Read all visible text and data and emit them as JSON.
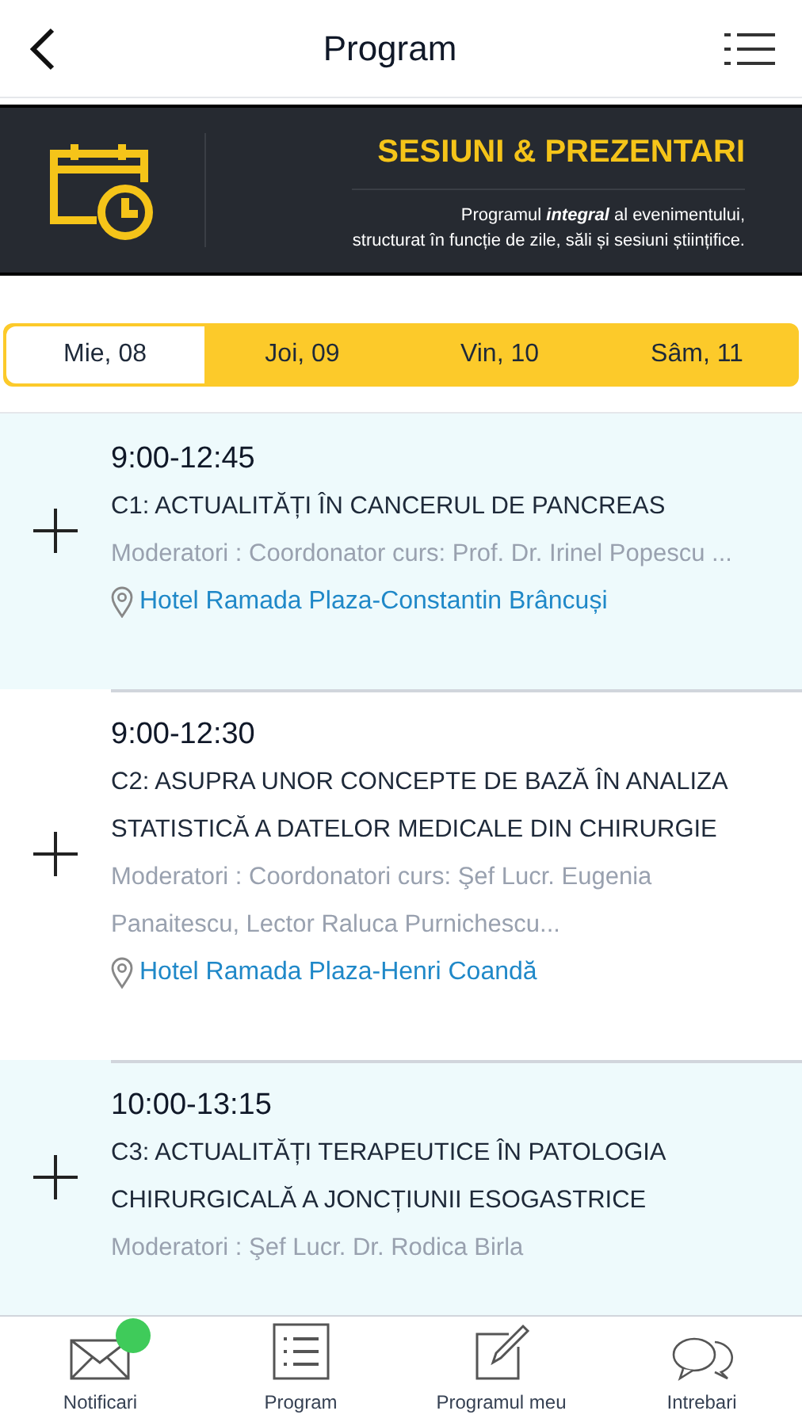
{
  "header": {
    "title": "Program"
  },
  "banner": {
    "title": "SESIUNI & PREZENTARI",
    "description_lines": [
      "Programul **integral** al evenimentului,",
      "structurat în funcție de zile, săli și sesiuni științifice."
    ]
  },
  "days": [
    {
      "label": "Mie, 08",
      "selected": true
    },
    {
      "label": "Joi, 09",
      "selected": false
    },
    {
      "label": "Vin, 10",
      "selected": false
    },
    {
      "label": "Sâm, 11",
      "selected": false
    }
  ],
  "sessions": [
    {
      "time": "9:00-12:45",
      "title": "C1: ACTUALITĂȚI ÎN CANCERUL DE PANCREAS",
      "moderators": "Moderatori : Coordonator curs: Prof. Dr. Irinel Popescu ...",
      "location": "Hotel Ramada Plaza-Constantin Brâncuși",
      "highlighted": true
    },
    {
      "time": "9:00-12:30",
      "title": "C2: ASUPRA UNOR CONCEPTE DE BAZĂ ÎN ANALIZA STATISTICĂ A DATELOR MEDICALE DIN CHIRURGIE",
      "moderators": "Moderatori : Coordonatori curs: Şef Lucr. Eugenia Panaitescu, Lector Raluca Purnichescu...",
      "location": "Hotel Ramada Plaza-Henri Coandă",
      "highlighted": false
    },
    {
      "time": "10:00-13:15",
      "title": "C3: ACTUALITĂȚI TERAPEUTICE ÎN PATOLOGIA CHIRURGICALĂ A JONCȚIUNII ESOGASTRICE",
      "moderators": "Moderatori : Şef Lucr. Dr. Rodica Birla",
      "highlighted": true
    }
  ],
  "tab_bar": [
    {
      "kind": "mail",
      "label": "Notificari",
      "badge": true
    },
    {
      "kind": "list",
      "label": "Program",
      "badge": false
    },
    {
      "kind": "edit",
      "label": "Programul meu",
      "badge": false
    },
    {
      "kind": "chat",
      "label": "Intrebari",
      "badge": false
    }
  ]
}
